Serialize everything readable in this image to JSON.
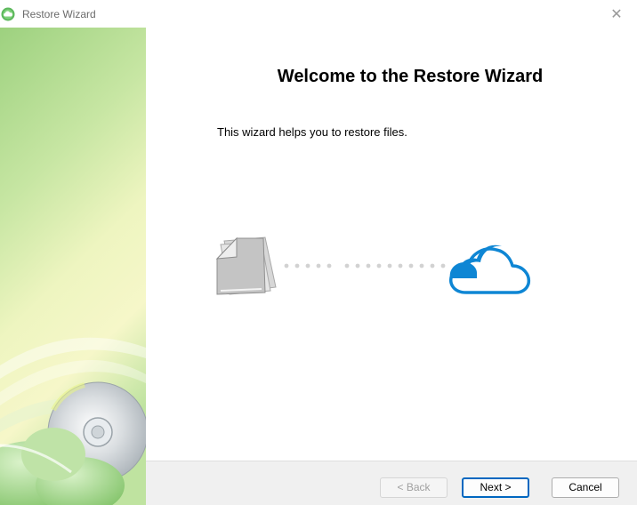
{
  "window": {
    "title": "Restore Wizard",
    "close_glyph": "✕",
    "icon": "green-cloud-app-icon"
  },
  "main": {
    "heading": "Welcome to the Restore Wizard",
    "description": "This wizard helps you to restore files.",
    "illustration": {
      "left_icon": "documents-icon",
      "right_icon": "cloud-icon",
      "connector": "dotted-line"
    }
  },
  "sidebar": {
    "art": "green-gradient-with-disc-and-cloud"
  },
  "footer": {
    "back_label": "< Back",
    "next_label": "Next >",
    "cancel_label": "Cancel"
  },
  "colors": {
    "accent": "#0067c0",
    "cloud_blue": "#0e86d4",
    "sidebar_green": "#a7d68a"
  }
}
